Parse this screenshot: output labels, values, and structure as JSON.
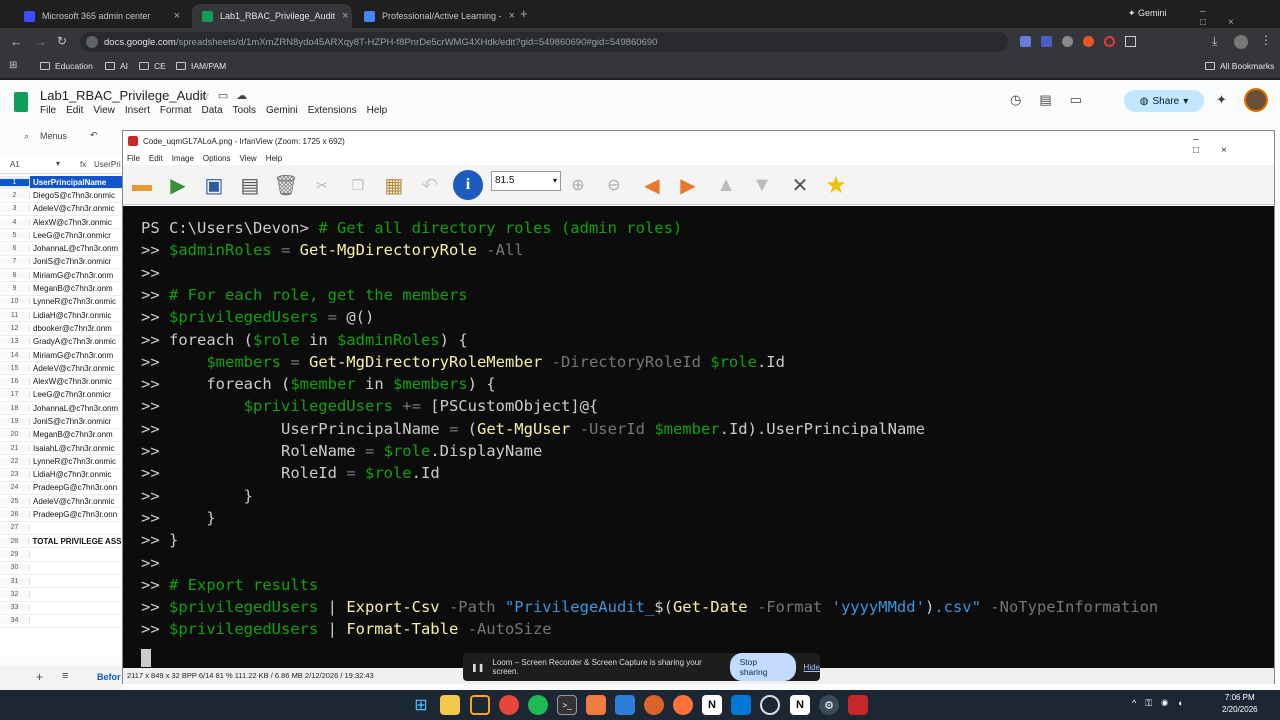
{
  "browser": {
    "tabs": [
      {
        "title": "Microsoft 365 admin center"
      },
      {
        "title": "Lab1_RBAC_Privilege_Audit"
      },
      {
        "title": "Professional/Active Learning - "
      }
    ],
    "gemini_label": "Gemini",
    "url_main": "docs.google.com",
    "url_rest": "/spreadsheets/d/1mXmZRN8ydo45ARXqy8T-HZPH-f8PnrDe5crWMG4XHdk/edit?gid=549860690#gid=549860690",
    "bookmarks": [
      "Education",
      "AI",
      "CE",
      "IAM/PAM"
    ],
    "all_bookmarks": "All Bookmarks"
  },
  "sheets": {
    "title": "Lab1_RBAC_Privilege_Audit",
    "menu": [
      "File",
      "Edit",
      "View",
      "Insert",
      "Format",
      "Data",
      "Tools",
      "Gemini",
      "Extensions",
      "Help"
    ],
    "share": "Share",
    "menus_search": "Menus",
    "namebox": "A1",
    "header_cell": "UserPrincipalName",
    "rows": [
      {
        "n": "2",
        "v": "DiegoS@c7hn3r.onmic"
      },
      {
        "n": "3",
        "v": "AdeleV@c7hn3r.onmic"
      },
      {
        "n": "4",
        "v": "AlexW@c7hn3r.onmic"
      },
      {
        "n": "5",
        "v": "LeeG@c7hn3r.onmicr"
      },
      {
        "n": "6",
        "v": "JohannaL@c7hn3r.onm"
      },
      {
        "n": "7",
        "v": "JoniS@c7hn3r.onmicr"
      },
      {
        "n": "8",
        "v": "MiriamG@c7hn3r.onm"
      },
      {
        "n": "9",
        "v": "MeganB@c7hn3r.onm"
      },
      {
        "n": "10",
        "v": "LynneR@c7hn3r.onmic"
      },
      {
        "n": "11",
        "v": "LidiaH@c7hn3r.onmic"
      },
      {
        "n": "12",
        "v": "dbooker@c7hn3r.onm"
      },
      {
        "n": "13",
        "v": "GradyA@c7hn3r.onmic"
      },
      {
        "n": "14",
        "v": "MiriamG@c7hn3r.onm"
      },
      {
        "n": "15",
        "v": "AdeleV@c7hn3r.onmic"
      },
      {
        "n": "16",
        "v": "AlexW@c7hn3r.onmic"
      },
      {
        "n": "17",
        "v": "LeeG@c7hn3r.onmicr"
      },
      {
        "n": "18",
        "v": "JohannaL@c7hn3r.onm"
      },
      {
        "n": "19",
        "v": "JoniS@c7hn3r.onmicr"
      },
      {
        "n": "20",
        "v": "MeganB@c7hn3r.onm"
      },
      {
        "n": "21",
        "v": "IsaiahL@c7hn3r.onmic"
      },
      {
        "n": "22",
        "v": "LynneR@c7hn3r.onmic"
      },
      {
        "n": "23",
        "v": "LidiaH@c7hn3r.onmic"
      },
      {
        "n": "24",
        "v": "PradeepG@c7hn3r.onn"
      },
      {
        "n": "25",
        "v": "AdeleV@c7hn3r.onmic"
      },
      {
        "n": "26",
        "v": "PradeepG@c7hn3r.onn"
      },
      {
        "n": "27",
        "v": ""
      },
      {
        "n": "28",
        "v": "TOTAL PRIVILEGE ASSI"
      },
      {
        "n": "29",
        "v": ""
      },
      {
        "n": "30",
        "v": ""
      },
      {
        "n": "31",
        "v": ""
      },
      {
        "n": "32",
        "v": ""
      },
      {
        "n": "33",
        "v": ""
      },
      {
        "n": "34",
        "v": ""
      }
    ],
    "sheet_tab": "Befor",
    "cell_a1_preview": "UserPri"
  },
  "irfanview": {
    "title": "Code_uqmGL7ALoA.png - IrfanView (Zoom: 1725 x 692)",
    "menu": [
      "File",
      "Edit",
      "Image",
      "Options",
      "View",
      "Help"
    ],
    "zoom": "81.5",
    "status": "2117 x 849 x 32 BPP    6/14    81 %    111.22 KB / 6.86 MB    2/12/2026 / 19:32:43"
  },
  "terminal": {
    "prompt": "PS C:\\Users\\Devon> ",
    "lines": [
      [
        [
          "cm",
          "# Get all directory roles (admin roles)"
        ]
      ],
      [
        [
          "vr",
          "$adminRoles"
        ],
        [
          "op",
          " = "
        ],
        [
          "cd",
          "Get-MgDirectoryRole"
        ],
        [
          "pm",
          " -All"
        ]
      ],
      [],
      [
        [
          "cm",
          "# For each role, get the members"
        ]
      ],
      [
        [
          "vr",
          "$privilegedUsers"
        ],
        [
          "op",
          " = "
        ],
        [
          "tx",
          "@()"
        ]
      ],
      [
        [
          "tx",
          "foreach ("
        ],
        [
          "vr",
          "$role"
        ],
        [
          "tx",
          " in "
        ],
        [
          "vr",
          "$adminRoles"
        ],
        [
          "tx",
          ") {"
        ]
      ],
      [
        [
          "tx",
          "    "
        ],
        [
          "vr",
          "$members"
        ],
        [
          "op",
          " = "
        ],
        [
          "cd",
          "Get-MgDirectoryRoleMember"
        ],
        [
          "pm",
          " -DirectoryRoleId "
        ],
        [
          "vr",
          "$role"
        ],
        [
          "tx",
          ".Id"
        ]
      ],
      [
        [
          "tx",
          "    foreach ("
        ],
        [
          "vr",
          "$member"
        ],
        [
          "tx",
          " in "
        ],
        [
          "vr",
          "$members"
        ],
        [
          "tx",
          ") {"
        ]
      ],
      [
        [
          "tx",
          "        "
        ],
        [
          "vr",
          "$privilegedUsers"
        ],
        [
          "op",
          " += "
        ],
        [
          "tx",
          "[PSCustomObject]@{"
        ]
      ],
      [
        [
          "tx",
          "            UserPrincipalName "
        ],
        [
          "op",
          "= "
        ],
        [
          "tx",
          "("
        ],
        [
          "cd",
          "Get-MgUser"
        ],
        [
          "pm",
          " -UserId "
        ],
        [
          "vr",
          "$member"
        ],
        [
          "tx",
          ".Id).UserPrincipalName"
        ]
      ],
      [
        [
          "tx",
          "            RoleName "
        ],
        [
          "op",
          "= "
        ],
        [
          "vr",
          "$role"
        ],
        [
          "tx",
          ".DisplayName"
        ]
      ],
      [
        [
          "tx",
          "            RoleId "
        ],
        [
          "op",
          "= "
        ],
        [
          "vr",
          "$role"
        ],
        [
          "tx",
          ".Id"
        ]
      ],
      [
        [
          "tx",
          "        }"
        ]
      ],
      [
        [
          "tx",
          "    }"
        ]
      ],
      [
        [
          "tx",
          "}"
        ]
      ],
      [],
      [
        [
          "cm",
          "# Export results"
        ]
      ],
      [
        [
          "vr",
          "$privilegedUsers"
        ],
        [
          "tx",
          " | "
        ],
        [
          "cd",
          "Export-Csv"
        ],
        [
          "pm",
          " -Path "
        ],
        [
          "st",
          "\"PrivilegeAudit_"
        ],
        [
          "tx",
          "$("
        ],
        [
          "cd",
          "Get-Date"
        ],
        [
          "pm",
          " -Format "
        ],
        [
          "st",
          "'yyyyMMdd'"
        ],
        [
          "tx",
          ")"
        ],
        [
          "st",
          ".csv\""
        ],
        [
          "pm",
          " -NoTypeInformation"
        ]
      ],
      [
        [
          "vr",
          "$privilegedUsers"
        ],
        [
          "tx",
          " | "
        ],
        [
          "cd",
          "Format-Table"
        ],
        [
          "pm",
          " -AutoSize"
        ]
      ]
    ],
    "continuation": ">> "
  },
  "loom": {
    "message": "Loom – Screen Recorder & Screen Capture is sharing your screen.",
    "stop": "Stop sharing",
    "hide": "Hide"
  },
  "taskbar": {
    "time": "7:06 PM",
    "date": "2/20/2026"
  }
}
